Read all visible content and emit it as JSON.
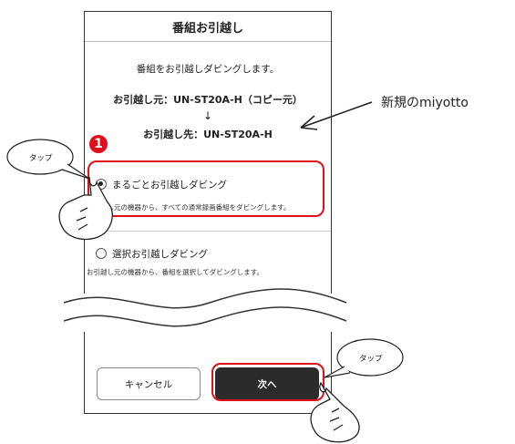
{
  "screen": {
    "title": "番組お引越し",
    "intro": "番組をお引越しダビングします。",
    "source_line": "お引越し元：UN-ST20A-H（コピー元）",
    "arrow": "↓",
    "dest_line": "お引越し先：UN-ST20A-H"
  },
  "options": [
    {
      "label": "まるごとお引越しダビング",
      "description": "お引越し元の機器から、すべての通常録画番組をダビングします。",
      "selected": true
    },
    {
      "label": "選択お引越しダビング",
      "description": "お引越し元の機器から、番組を選択してダビングします。",
      "selected": false
    }
  ],
  "buttons": {
    "cancel": "キャンセル",
    "next": "次へ"
  },
  "annotations": {
    "new_device_label": "新規のmiyotto",
    "tap_bubble_1": "タップ",
    "tap_bubble_2": "タップ",
    "step_badge": "1"
  },
  "colors": {
    "highlight": "#e0101a",
    "next_button": "#2b2b2b"
  }
}
